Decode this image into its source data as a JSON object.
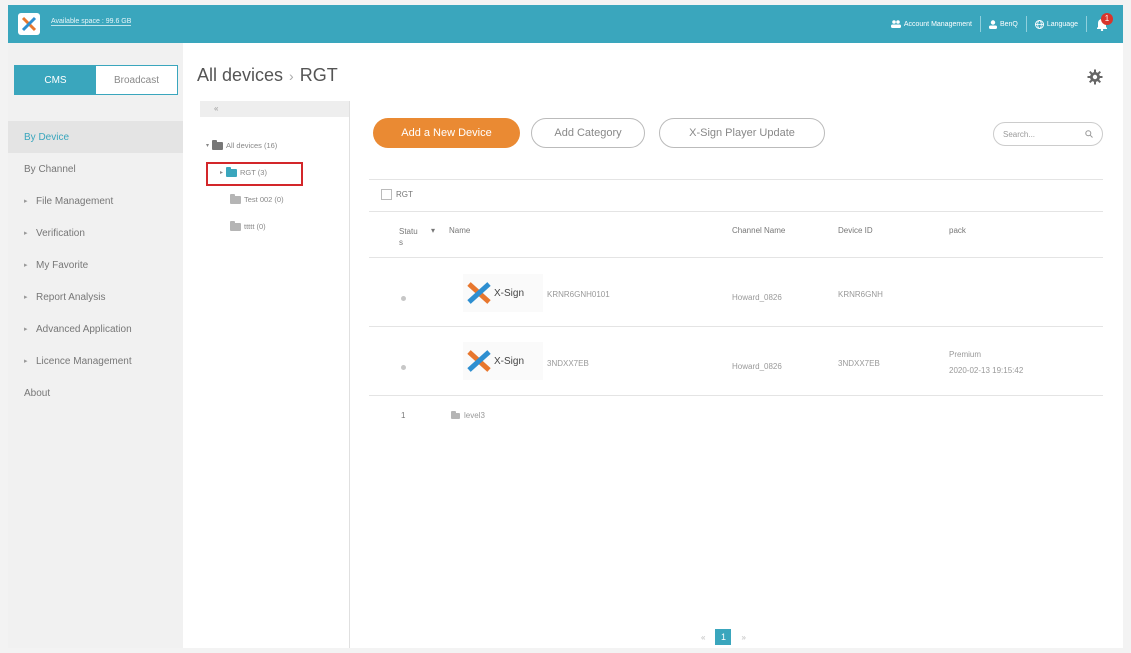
{
  "topbar": {
    "available_space": "Available space : 99.6 GB",
    "account_management": "Account Management",
    "user": "BenQ",
    "language": "Language",
    "notification_count": "1"
  },
  "sidebar": {
    "tabs": [
      {
        "label": "CMS",
        "active": true
      },
      {
        "label": "Broadcast",
        "active": false
      }
    ],
    "items": [
      {
        "label": "By Device",
        "active": true,
        "caret": false
      },
      {
        "label": "By Channel",
        "active": false,
        "caret": false
      },
      {
        "label": "File Management",
        "active": false,
        "caret": true
      },
      {
        "label": "Verification",
        "active": false,
        "caret": true
      },
      {
        "label": "My Favorite",
        "active": false,
        "caret": true
      },
      {
        "label": "Report Analysis",
        "active": false,
        "caret": true
      },
      {
        "label": "Advanced Application",
        "active": false,
        "caret": true
      },
      {
        "label": "Licence Management",
        "active": false,
        "caret": true
      },
      {
        "label": "About",
        "active": false,
        "caret": false
      }
    ]
  },
  "header": {
    "crumb_root": "All devices",
    "crumb_sep": "›",
    "crumb_current": "RGT"
  },
  "tree": {
    "collapse": "«",
    "items": [
      {
        "label": "All devices (16)"
      },
      {
        "label": "RGT (3)"
      },
      {
        "label": "Test 002 (0)"
      },
      {
        "label": "ttttt (0)"
      }
    ]
  },
  "toolbar": {
    "add_device": "Add a New Device",
    "add_category": "Add Category",
    "player_update": "X-Sign Player Update",
    "search_placeholder": "Search..."
  },
  "table": {
    "group_label": "RGT",
    "headers": {
      "status": "Statu s",
      "name": "Name",
      "channel": "Channel Name",
      "device_id": "Device ID",
      "pack": "pack"
    },
    "rows": [
      {
        "thumb_text": "X-Sign",
        "name": "KRNR6GNH0101",
        "channel": "Howard_0826",
        "device_id": "KRNR6GNH",
        "pack": "",
        "pack_date": ""
      },
      {
        "thumb_text": "X-Sign",
        "name": "3NDXX7EB",
        "channel": "Howard_0826",
        "device_id": "3NDXX7EB",
        "pack": "Premium",
        "pack_date": "2020-02-13 19:15:42"
      }
    ],
    "folder_row": {
      "status": "1",
      "name": "level3"
    }
  },
  "pager": {
    "prev": "«",
    "current": "1",
    "next": "»"
  },
  "colors": {
    "accent": "#3aa6bd",
    "primary_button": "#ea8a33",
    "highlight_border": "#d3262a"
  }
}
